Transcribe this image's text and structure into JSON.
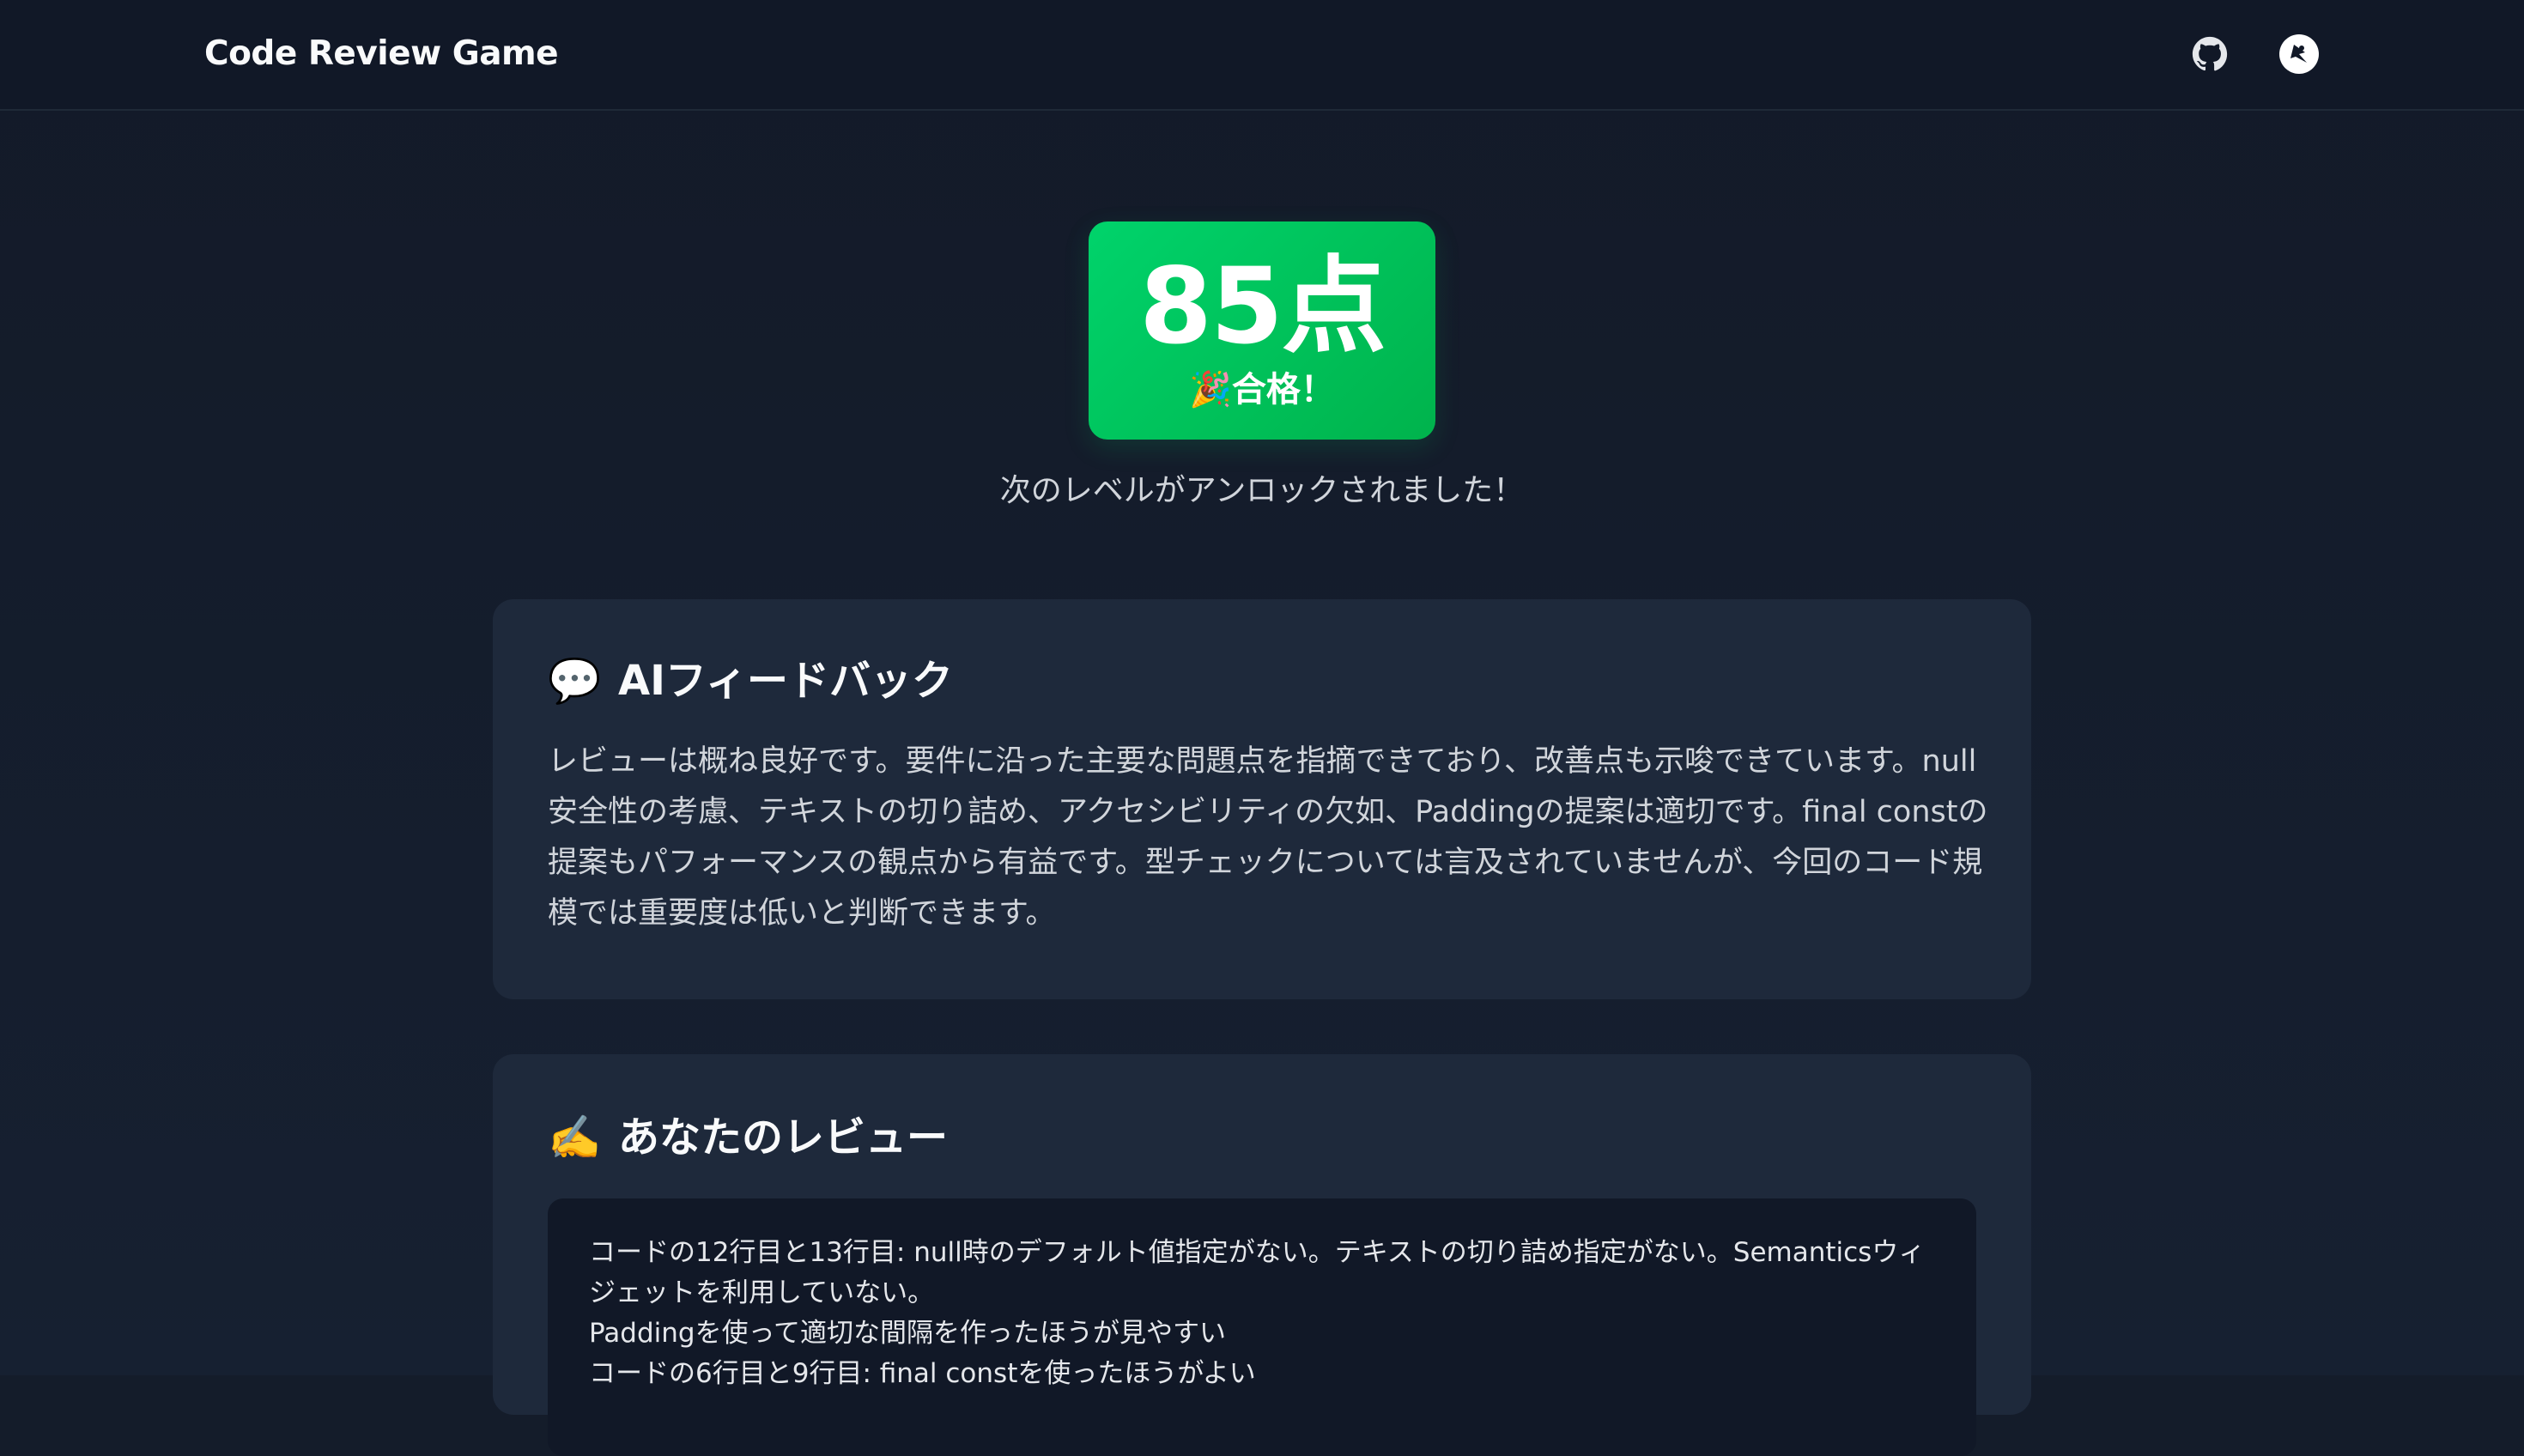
{
  "header": {
    "title": "Code Review Game",
    "icons": [
      "github-icon",
      "account-icon"
    ]
  },
  "result": {
    "score": "85点",
    "status": "🎉合格！",
    "message": "次のレベルがアンロックされました！"
  },
  "feedback": {
    "icon": "💬",
    "title": "AIフィードバック",
    "body": "レビューは概ね良好です。要件に沿った主要な問題点を指摘できており、改善点も示唆できています。null安全性の考慮、テキストの切り詰め、アクセシビリティの欠如、Paddingの提案は適切です。final constの提案もパフォーマンスの観点から有益です。型チェックについては言及されていませんが、今回のコード規模では重要度は低いと判断できます。"
  },
  "review": {
    "icon": "✍️",
    "title": "あなたのレビュー",
    "body": "コードの12行目と13行目: null時のデフォルト値指定がない。テキストの切り詰め指定がない。Semanticsウィジェットを利用していない。\nPaddingを使って適切な間隔を作ったほうが見やすい\nコードの6行目と9行目: final constを使ったほうがよい"
  },
  "colors": {
    "background": "#141c2a",
    "header": "#111827",
    "card": "#1e293b",
    "review_box": "#111827",
    "badge_start": "#00d36b",
    "badge_end": "#00b34c"
  }
}
